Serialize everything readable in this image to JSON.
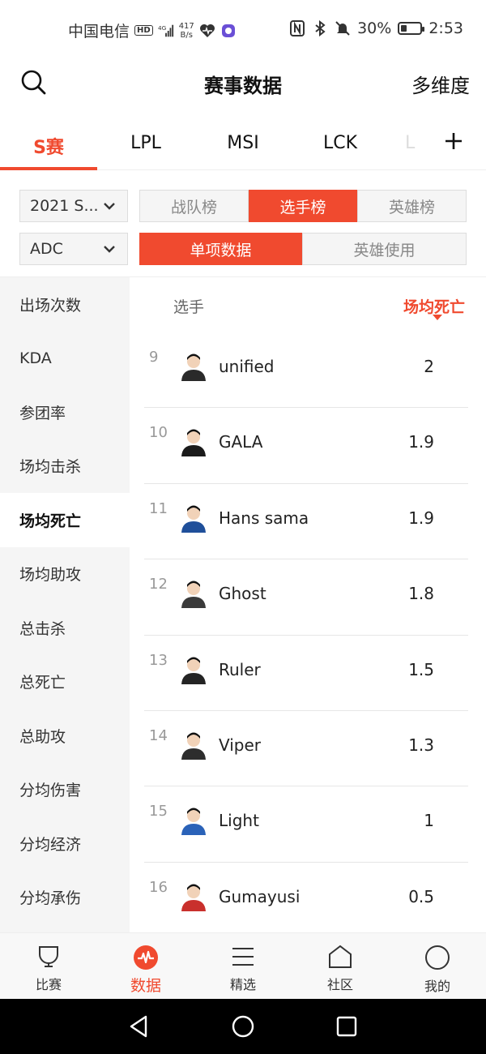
{
  "status_bar": {
    "carrier": "中国电信",
    "hd": "HD",
    "net_type": "4G",
    "speed_value": "417",
    "speed_unit": "B/s",
    "battery": "30%",
    "battery_level": 0.3,
    "time": "2:53"
  },
  "header": {
    "title": "赛事数据",
    "multi_dimension": "多维度"
  },
  "league_tabs": [
    {
      "label": "S赛",
      "active": true
    },
    {
      "label": "LPL",
      "active": false
    },
    {
      "label": "MSI",
      "active": false
    },
    {
      "label": "LCK",
      "active": false
    }
  ],
  "league_tab_partial": "L",
  "filters": {
    "season": "2021 S...",
    "position": "ADC",
    "rank_tabs": [
      "战队榜",
      "选手榜",
      "英雄榜"
    ],
    "rank_active_index": 1,
    "data_tabs": [
      "单项数据",
      "英雄使用"
    ],
    "data_active_index": 0
  },
  "sidebar": {
    "items": [
      "出场次数",
      "KDA",
      "参团率",
      "场均击杀",
      "场均死亡",
      "场均助攻",
      "总击杀",
      "总死亡",
      "总助攻",
      "分均伤害",
      "分均经济",
      "分均承伤"
    ],
    "active_index": 4
  },
  "table": {
    "col_player": "选手",
    "col_stat": "场均死亡",
    "rows": [
      {
        "rank": "9",
        "name": "unified",
        "value": "2"
      },
      {
        "rank": "10",
        "name": "GALA",
        "value": "1.9"
      },
      {
        "rank": "11",
        "name": "Hans sama",
        "value": "1.9"
      },
      {
        "rank": "12",
        "name": "Ghost",
        "value": "1.8"
      },
      {
        "rank": "13",
        "name": "Ruler",
        "value": "1.5"
      },
      {
        "rank": "14",
        "name": "Viper",
        "value": "1.3"
      },
      {
        "rank": "15",
        "name": "Light",
        "value": "1"
      },
      {
        "rank": "16",
        "name": "Gumayusi",
        "value": "0.5"
      }
    ]
  },
  "bottom_nav": [
    {
      "label": "比赛",
      "icon": "cup-icon"
    },
    {
      "label": "数据",
      "icon": "pulse-icon"
    },
    {
      "label": "精选",
      "icon": "menu-lines-icon"
    },
    {
      "label": "社区",
      "icon": "house-icon"
    },
    {
      "label": "我的",
      "icon": "profile-circle-icon"
    }
  ],
  "bottom_nav_active_index": 1,
  "colors": {
    "accent": "#f04a2f",
    "sidebar_bg": "#f5f5f5"
  }
}
